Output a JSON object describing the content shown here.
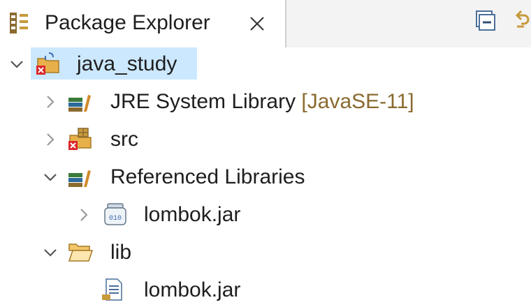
{
  "tab": {
    "title": "Package Explorer"
  },
  "tree": {
    "project": {
      "label": "java_study",
      "expanded": true
    },
    "jre": {
      "label": "JRE System Library",
      "decoration": "[JavaSE-11]",
      "expanded": false
    },
    "src": {
      "label": "src",
      "expanded": false
    },
    "refs": {
      "label": "Referenced Libraries",
      "expanded": true
    },
    "refs_jar": {
      "label": "lombok.jar",
      "expanded": false
    },
    "lib": {
      "label": "lib",
      "expanded": true
    },
    "lib_jar": {
      "label": "lombok.jar"
    }
  },
  "icons": {
    "tab": "package-explorer-icon",
    "close": "close-icon",
    "collapse_all": "collapse-all-icon",
    "link_editor": "link-with-editor-icon",
    "project": "java-project-error-icon",
    "library": "library-icon",
    "package_root": "source-folder-error-icon",
    "jar": "jar-file-icon",
    "folder": "open-folder-icon",
    "file": "file-icon"
  },
  "colors": {
    "selection": "#cce8ff",
    "decoration": "#8a6a2f",
    "error": "#d9262c",
    "folder": "#e8b04a"
  }
}
